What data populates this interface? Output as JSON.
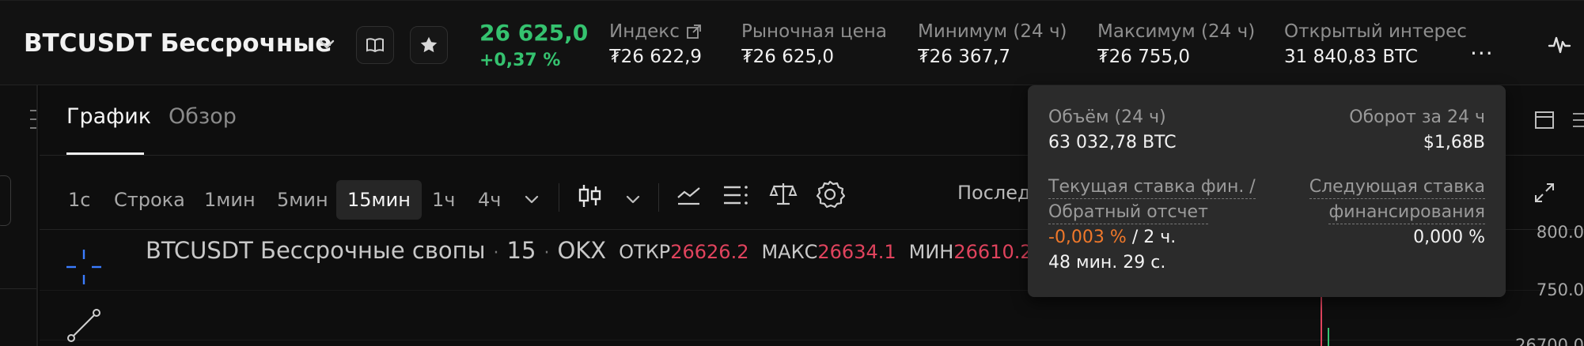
{
  "header": {
    "symbol": "BTCUSDT Бессрочные",
    "last_price": "26 625,0",
    "change_pct": "+0,37 %",
    "stats": [
      {
        "label": "Индекс",
        "value": "₮26 622,9",
        "has_link_icon": true
      },
      {
        "label": "Рыночная цена",
        "value": "₮26 625,0"
      },
      {
        "label": "Минимум (24 ч)",
        "value": "₮26 367,7"
      },
      {
        "label": "Максимум (24 ч)",
        "value": "₮26 755,0"
      },
      {
        "label": "Открытый интерес",
        "value": "31 840,83 BTC"
      }
    ],
    "more": "..."
  },
  "tabs": [
    {
      "label": "График",
      "active": true
    },
    {
      "label": "Обзор",
      "active": false
    }
  ],
  "timeframes": [
    {
      "label": "1с",
      "active": false
    },
    {
      "label": "Строка",
      "active": false
    },
    {
      "label": "1мин",
      "active": false
    },
    {
      "label": "5мин",
      "active": false
    },
    {
      "label": "15мин",
      "active": true
    },
    {
      "label": "1ч",
      "active": false
    },
    {
      "label": "4ч",
      "active": false
    }
  ],
  "price_type_selector": "Послед",
  "legend": {
    "name": "BTCUSDT Бессрочные свопы",
    "interval": "15",
    "exchange": "OKX",
    "open_label": "ОТКР",
    "open_value": "26626.2",
    "high_label": "МАКС",
    "high_value": "26634.1",
    "low_label": "МИН",
    "low_value": "26610.2"
  },
  "price_scale": [
    "800.0",
    "750.0",
    "26700.0"
  ],
  "tooltip": {
    "volume_label": "Объём (24 ч)",
    "volume_value": "63 032,78 BTC",
    "turnover_label": "Оборот за 24 ч",
    "turnover_value": "$1,68B",
    "funding_label_line1": "Текущая ставка фин. /",
    "funding_label_line2": "Обратный отсчет",
    "funding_rate": "-0,003 %",
    "funding_countdown_a": " / 2 ч.",
    "funding_countdown_b": "48 мин. 29 с.",
    "next_funding_label_line1": "Следующая ставка",
    "next_funding_label_line2": "финансирования",
    "next_funding_value": "0,000 %"
  },
  "colors": {
    "positive": "#35c26f",
    "negative": "#e0435d",
    "funding_negative": "#f0782a",
    "background": "#121212",
    "tooltip_bg": "#2b2b2b"
  },
  "icons": [
    "chevron-down-icon",
    "book-icon",
    "star-icon",
    "external-link-icon",
    "more-icon",
    "activity-icon",
    "candles-icon",
    "indicators-icon",
    "list-icon",
    "scales-icon",
    "gear-icon",
    "layout-icon",
    "expand-icon",
    "crosshair-icon",
    "trend-line-icon"
  ]
}
